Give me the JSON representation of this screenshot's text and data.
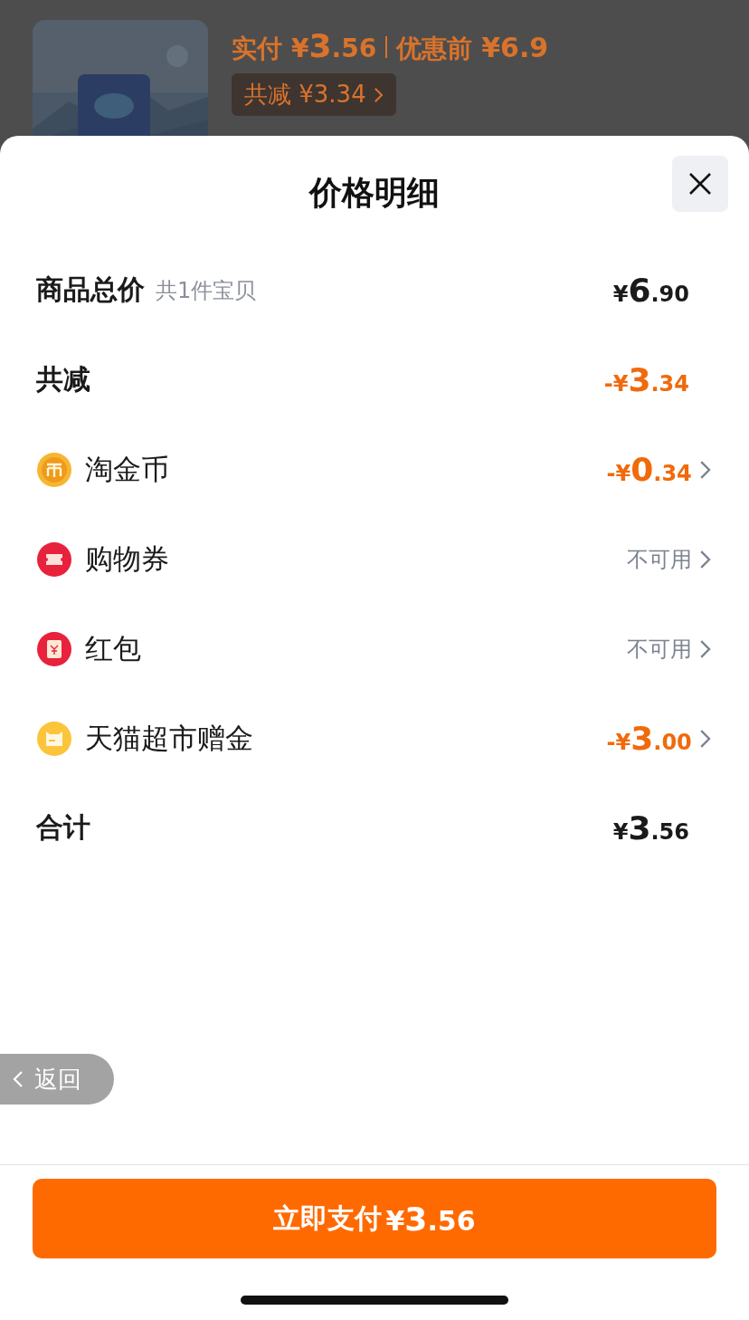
{
  "backdrop": {
    "paid_label": "实付",
    "paid_amount": "¥3.56",
    "before_label": "优惠前",
    "before_amount": "¥6.9",
    "discount_chip": "共减 ¥3.34"
  },
  "sheet": {
    "title": "价格明细",
    "rows": [
      {
        "kind": "header_amount",
        "label": "商品总价",
        "note": "共1件宝贝",
        "value": "¥6.90",
        "has_arrow": false
      },
      {
        "kind": "header_discount",
        "label": "共减",
        "value": "-¥3.34",
        "has_arrow": false
      },
      {
        "kind": "item_discount",
        "label": "淘金币",
        "value": "-¥0.34",
        "has_arrow": true
      },
      {
        "kind": "item_status",
        "label": "购物券",
        "value": "不可用",
        "has_arrow": true
      },
      {
        "kind": "item_status",
        "label": "红包",
        "value": "不可用",
        "has_arrow": true
      },
      {
        "kind": "item_discount",
        "label": "天猫超市赠金",
        "value": "-¥3.00",
        "has_arrow": true
      },
      {
        "kind": "header_amount",
        "label": "合计",
        "value": "¥3.56",
        "has_arrow": false
      }
    ],
    "back_button": "返回",
    "pay_button": {
      "label": "立即支付",
      "amount": "¥3.56"
    }
  }
}
